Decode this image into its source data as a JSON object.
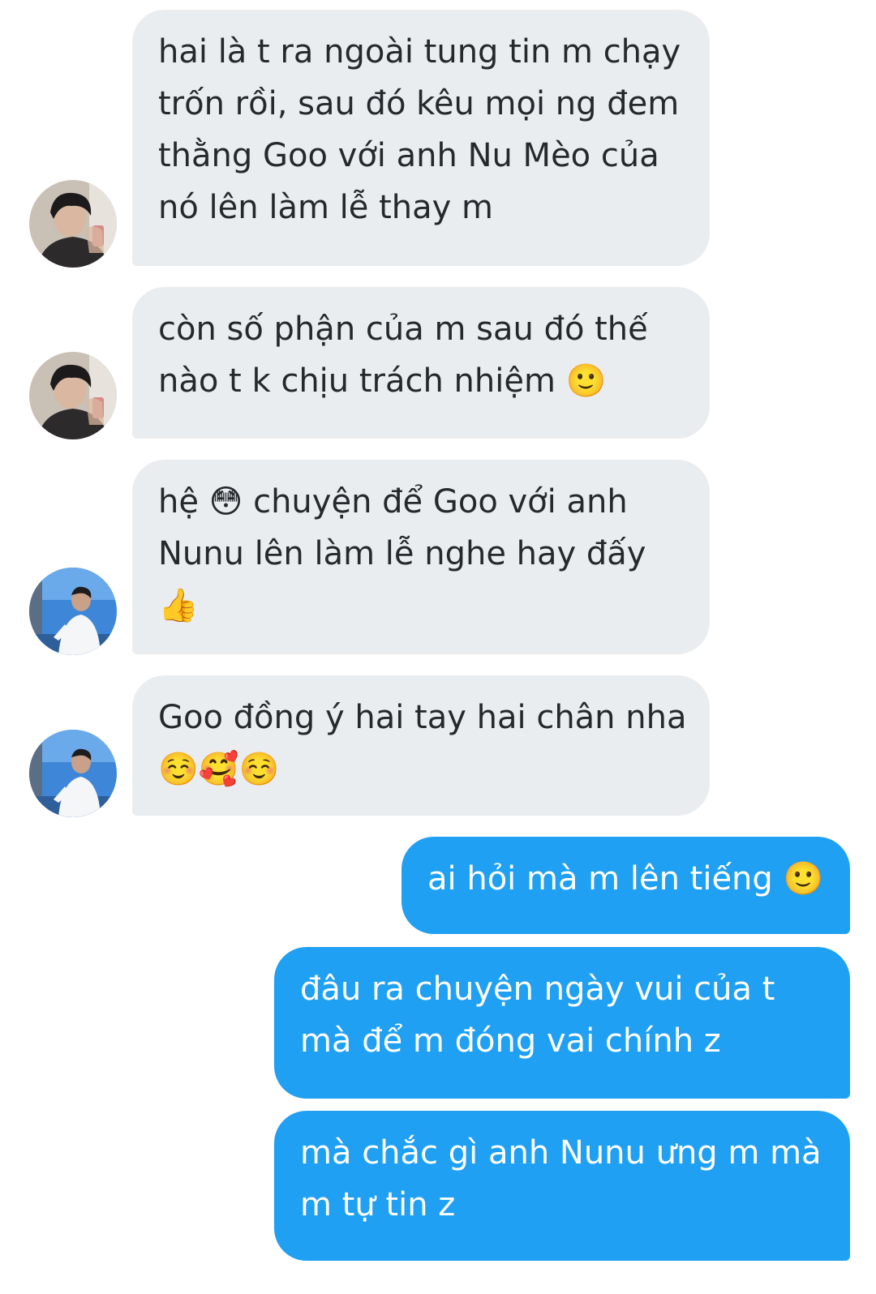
{
  "conversation": {
    "messages": [
      {
        "direction": "incoming",
        "sender_avatar": "avatar-1",
        "lines": [
          "hai là t ra ngoài tung tin m chạy",
          "trốn rồi, sau đó kêu mọi ng đem",
          "thằng Goo với anh Nu Mèo của",
          "nó lên làm lễ thay m"
        ]
      },
      {
        "direction": "incoming",
        "sender_avatar": "avatar-1",
        "lines": [
          "còn số phận của m sau đó thế",
          "nào t k chịu trách nhiệm 🙂"
        ]
      },
      {
        "direction": "incoming",
        "sender_avatar": "avatar-2",
        "lines": [
          "hệ 😳 chuyện để Goo với anh",
          "Nunu lên làm lễ nghe hay đấy",
          "👍"
        ]
      },
      {
        "direction": "incoming",
        "sender_avatar": "avatar-2",
        "lines": [
          "Goo đồng ý hai tay hai chân nha",
          "☺️🥰☺️"
        ]
      },
      {
        "direction": "outgoing",
        "lines": [
          "ai hỏi mà m lên tiếng 🙂"
        ]
      },
      {
        "direction": "outgoing",
        "lines": [
          "đâu ra chuyện ngày vui của t",
          "mà để m đóng vai chính z"
        ]
      },
      {
        "direction": "outgoing",
        "lines": [
          "mà chắc gì anh Nunu ưng m mà",
          "m tự tin z"
        ]
      }
    ]
  },
  "colors": {
    "incoming_bubble": "#eaedf0",
    "incoming_text": "#24292e",
    "outgoing_bubble": "#20a0f2",
    "outgoing_text": "#ffffff",
    "background": "#ffffff"
  },
  "avatars": {
    "avatar-1": {
      "icon": "person-selfie-photo"
    },
    "avatar-2": {
      "icon": "person-beach-photo"
    }
  }
}
